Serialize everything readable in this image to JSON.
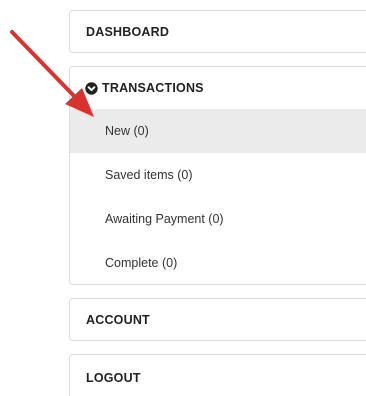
{
  "menu": {
    "dashboard": "DASHBOARD",
    "transactions": {
      "label": "TRANSACTIONS",
      "expand_icon": "chevron-down-circle-icon",
      "items": [
        {
          "label": "New (0)",
          "active": true
        },
        {
          "label": "Saved items (0)",
          "active": false
        },
        {
          "label": "Awaiting Payment (0)",
          "active": false
        },
        {
          "label": "Complete (0)",
          "active": false
        }
      ]
    },
    "account": "ACCOUNT",
    "logout": "LOGOUT"
  },
  "annotation": {
    "type": "red-arrow",
    "color": "#d9332e",
    "points_to": "New (0)"
  },
  "colors": {
    "active_item_bg": "#ebebeb",
    "border": "#dcdcdc"
  }
}
